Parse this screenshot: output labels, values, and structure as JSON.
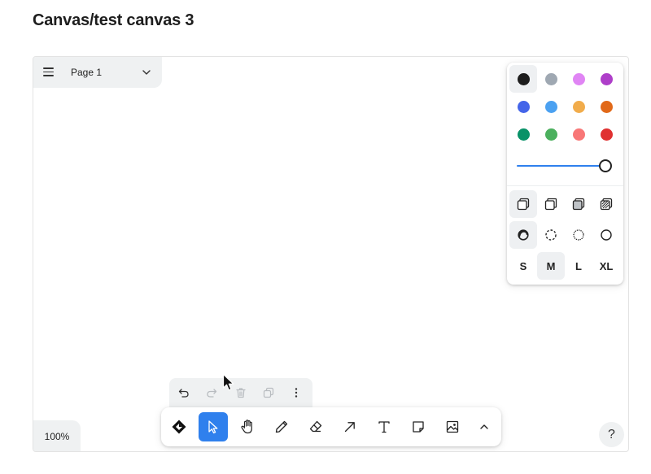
{
  "page": {
    "title": "Canvas/test canvas 3"
  },
  "page_menu": {
    "label": "Page 1",
    "menu_icon": "hamburger-icon",
    "dropdown_icon": "chevron-down-icon"
  },
  "style_panel": {
    "colors": [
      {
        "name": "black",
        "hex": "#1d1d1d",
        "selected": true
      },
      {
        "name": "grey",
        "hex": "#9fa8b2",
        "selected": false
      },
      {
        "name": "light-violet",
        "hex": "#e085f4",
        "selected": false
      },
      {
        "name": "violet",
        "hex": "#ae3ec9",
        "selected": false
      },
      {
        "name": "blue",
        "hex": "#4465e9",
        "selected": false
      },
      {
        "name": "light-blue",
        "hex": "#4ba1f1",
        "selected": false
      },
      {
        "name": "yellow",
        "hex": "#f1ac4b",
        "selected": false
      },
      {
        "name": "orange",
        "hex": "#e16919",
        "selected": false
      },
      {
        "name": "green",
        "hex": "#099268",
        "selected": false
      },
      {
        "name": "light-green",
        "hex": "#4cb05e",
        "selected": false
      },
      {
        "name": "light-red",
        "hex": "#f87777",
        "selected": false
      },
      {
        "name": "red",
        "hex": "#e03131",
        "selected": false
      }
    ],
    "opacity": 1.0,
    "fill_styles": [
      {
        "name": "fill-none-icon",
        "selected": true
      },
      {
        "name": "fill-semi-icon",
        "selected": false
      },
      {
        "name": "fill-solid-icon",
        "selected": false
      },
      {
        "name": "fill-pattern-icon",
        "selected": false
      }
    ],
    "dash_styles": [
      {
        "name": "dash-draw-icon",
        "selected": true
      },
      {
        "name": "dash-dashed-icon",
        "selected": false
      },
      {
        "name": "dash-dotted-icon",
        "selected": false
      },
      {
        "name": "dash-solid-icon",
        "selected": false
      }
    ],
    "sizes": [
      {
        "label": "S",
        "selected": false
      },
      {
        "label": "M",
        "selected": true
      },
      {
        "label": "L",
        "selected": false
      },
      {
        "label": "XL",
        "selected": false
      }
    ]
  },
  "edit_bar": [
    "undo-icon",
    "redo-icon",
    "trash-icon",
    "duplicate-icon",
    "more-icon"
  ],
  "toolbar": {
    "tools": [
      "action-menu-icon",
      "select-icon",
      "hand-icon",
      "pencil-icon",
      "eraser-icon",
      "arrow-icon",
      "text-icon",
      "note-icon",
      "image-icon",
      "chevron-up-icon"
    ],
    "active": "select-icon",
    "accent": "#2f80ed"
  },
  "zoom": {
    "label": "100%"
  },
  "help": {
    "label": "?"
  }
}
